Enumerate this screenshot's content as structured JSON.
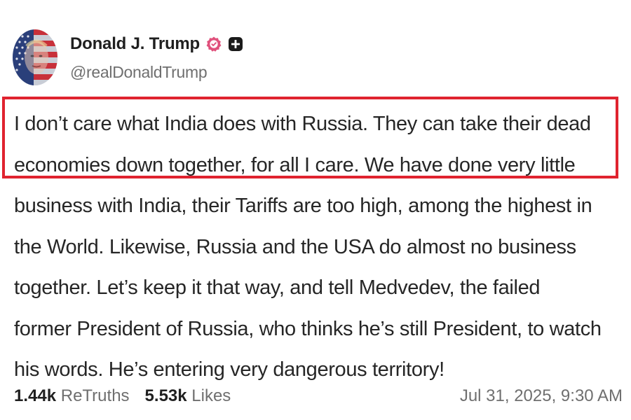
{
  "author": {
    "display_name": "Donald J. Trump",
    "handle": "@realDonaldTrump",
    "avatar_icon": "avatar-flag-portrait",
    "verified_icon": "verified-badge-icon",
    "verified_color": "#e0517c",
    "plus_icon": "plus-badge-icon"
  },
  "post": {
    "lines": [
      "I don’t care what India does with Russia. They can take their dead",
      "economies down together, for all I care. We have done very little",
      "business with India, their Tariffs are too high, among the highest in",
      "the World. Likewise, Russia and the USA do almost no business",
      "together. Let’s keep it that way, and tell Medvedev, the failed",
      "former President of Russia, who thinks he’s still President, to watch",
      "his words. He’s entering very dangerous territory!"
    ],
    "highlight_color": "#e0232f"
  },
  "stats": {
    "retruths_count": "1.44k",
    "retruths_label": "ReTruths",
    "likes_count": "5.53k",
    "likes_label": "Likes"
  },
  "timestamp": "Jul 31, 2025, 9:30 AM"
}
